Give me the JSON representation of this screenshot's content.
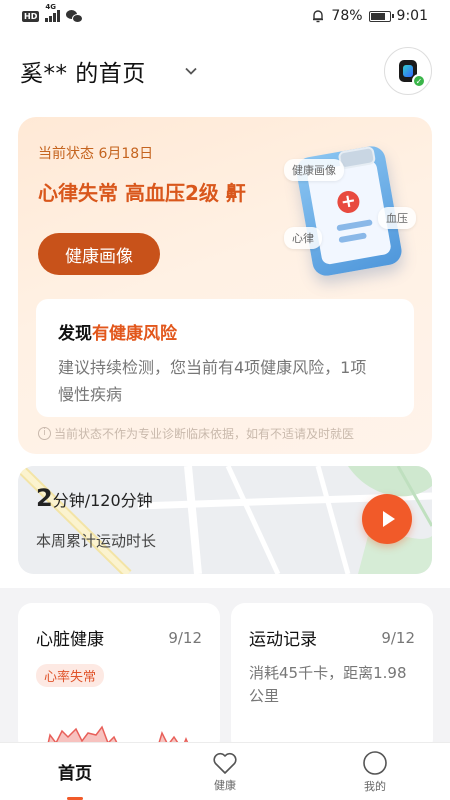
{
  "status_bar": {
    "battery": "78%",
    "time": "9:01",
    "network": "4G",
    "hd": "HD"
  },
  "header": {
    "title": "奚** 的首页"
  },
  "state_card": {
    "date": "当前状态 6月18日",
    "headline": "心律失常 高血压2级 鼾",
    "portrait_button": "健康画像",
    "chips": [
      "健康画像",
      "血压",
      "心律"
    ],
    "risk_title_prefix": "发现",
    "risk_title_highlight": "有健康风险",
    "risk_desc": "建议持续检测，您当前有4项健康风险，1项慢性疾病",
    "disclaimer": "当前状态不作为专业诊断临床依据，如有不适请及时就医"
  },
  "exercise": {
    "value": "2",
    "unit": "分钟/120分钟",
    "label": "本周累计运动时长"
  },
  "heart_card": {
    "title": "心脏健康",
    "date": "9/12",
    "badge": "心率失常"
  },
  "sport_card": {
    "title": "运动记录",
    "date": "9/12",
    "desc": "消耗45千卡，距离1.98公里"
  },
  "nav": {
    "home": "首页",
    "health": "健康",
    "mine": "我的"
  },
  "colors": {
    "accent": "#f15a29",
    "headline": "#d9571c",
    "button": "#c8521a"
  }
}
